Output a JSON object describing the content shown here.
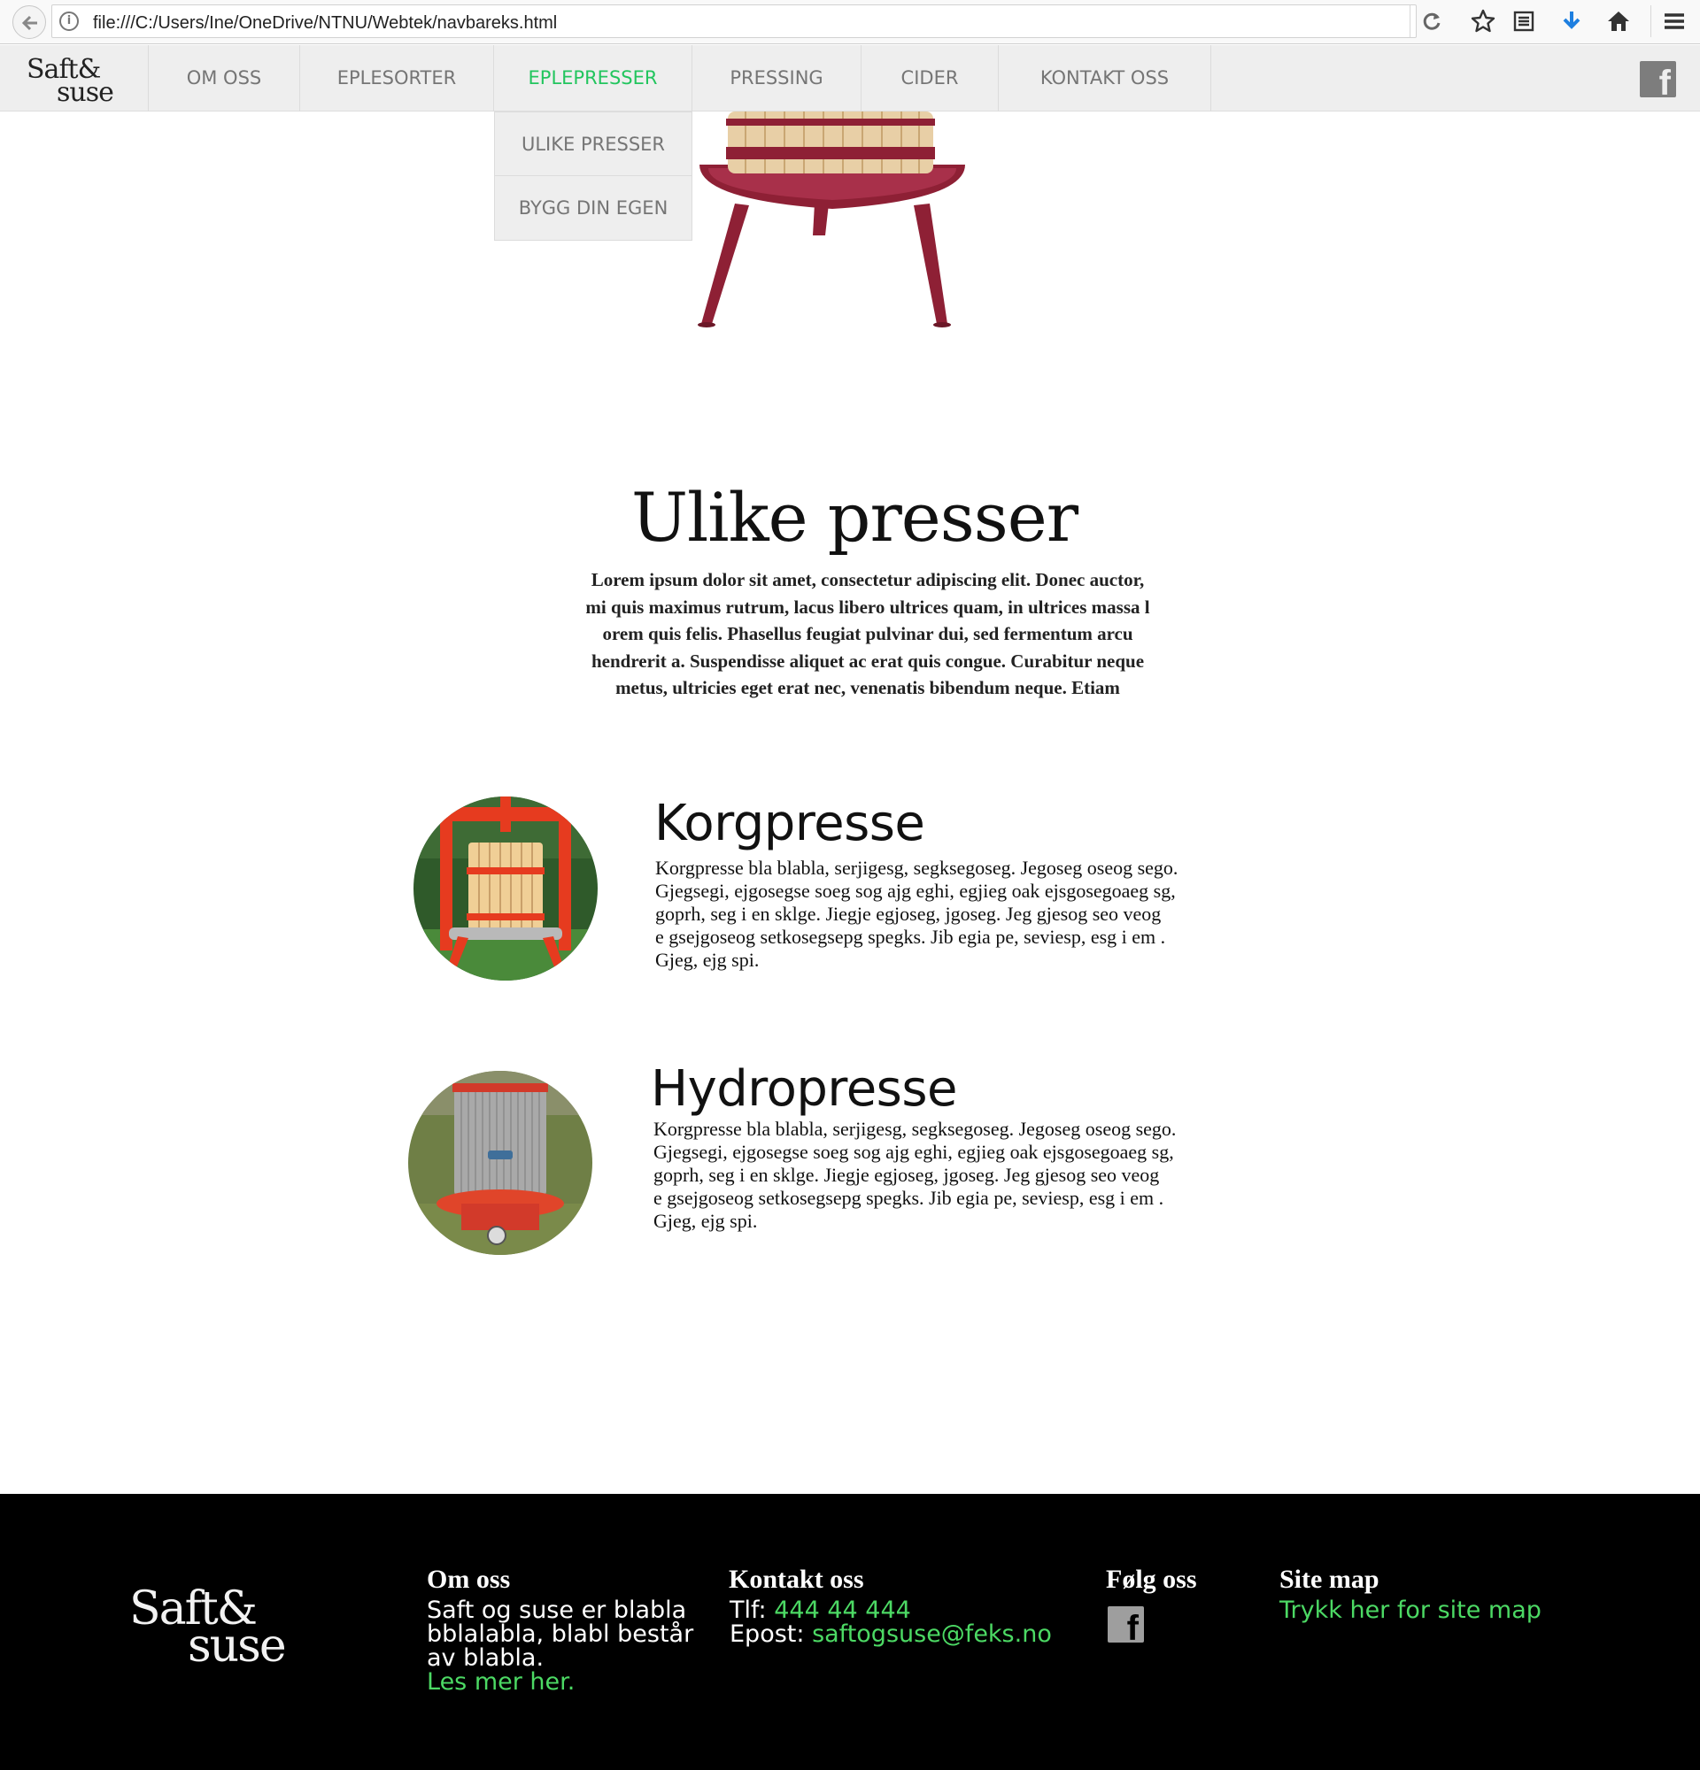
{
  "browser": {
    "url": "file:///C:/Users/Ine/OneDrive/NTNU/Webtek/navbareks.html",
    "info_glyph": "i"
  },
  "nav": {
    "logo_line1": "Saft&",
    "logo_line2": "suse",
    "items": [
      {
        "label": "OM OSS"
      },
      {
        "label": "EPLESORTER"
      },
      {
        "label": "EPLEPRESSER"
      },
      {
        "label": "PRESSING"
      },
      {
        "label": "CIDER"
      },
      {
        "label": "KONTAKT OSS"
      }
    ],
    "active_item": "EPLEPRESSER",
    "active_color": "#22c55e",
    "dropdown": [
      "ULIKE PRESSER",
      "BYGG DIN EGEN"
    ],
    "social_icon": "facebook-icon",
    "social_glyph": "f"
  },
  "intro": {
    "title": "Ulike presser",
    "lines": [
      "Lorem ipsum dolor sit amet, consectetur adipiscing elit. Donec auctor,",
      "mi quis maximus rutrum, lacus libero ultrices quam, in ultrices massa l",
      "orem quis felis. Phasellus feugiat pulvinar dui, sed fermentum arcu",
      "hendrerit a. Suspendisse aliquet ac erat quis congue. Curabitur neque",
      "metus, ultricies eget erat nec, venenatis bibendum neque. Etiam"
    ]
  },
  "presses": [
    {
      "title": "Korgpresse",
      "lines": [
        "Korgpresse bla blabla, serjigesg, segksegoseg. Jegoseg oseog sego.",
        "Gjegsegi, ejgosegse soeg sog ajg eghi, egjieg oak ejsgosegoaeg sg,",
        "goprh, seg i en sklge. Jiegje egjoseg, jgoseg. Jeg gjesog seo veog",
        "e gsejgoseog setkosegsepg spegks. Jib egia pe, seviesp, esg i em .",
        "Gjeg, ejg spi."
      ]
    },
    {
      "title": "Hydropresse",
      "lines": [
        "Korgpresse bla blabla, serjigesg, segksegoseg. Jegoseg oseog sego.",
        "Gjegsegi, ejgosegse soeg sog ajg eghi, egjieg oak ejsgosegoaeg sg,",
        "goprh, seg i en sklge. Jiegje egjoseg, jgoseg. Jeg gjesog seo veog",
        "e gsejgoseog setkosegsepg spegks. Jib egia pe, seviesp, esg i em .",
        "Gjeg, ejg spi."
      ]
    }
  ],
  "footer": {
    "logo_line1": "Saft&",
    "logo_line2": "suse",
    "about": {
      "heading": "Om oss",
      "line1": "Saft og suse er blabla",
      "line2": "bblalabla, blabl består",
      "line3": "av blabla.",
      "link": "Les mer her."
    },
    "contact": {
      "heading": "Kontakt oss",
      "phone_label": "Tlf: ",
      "phone": "444 44 444",
      "email_label": "Epost: ",
      "email": "saftogsuse@feks.no"
    },
    "follow": {
      "heading": "Følg oss",
      "icon": "facebook-icon",
      "glyph": "f"
    },
    "sitemap": {
      "heading": "Site map",
      "link": "Trykk her for site map"
    },
    "link_color": "#4cd964"
  }
}
